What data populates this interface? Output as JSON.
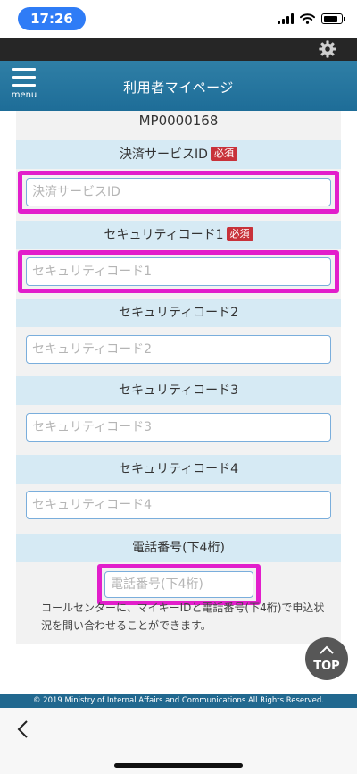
{
  "status_bar": {
    "time": "17:26"
  },
  "header": {
    "menu_label": "menu",
    "title": "利用者マイページ"
  },
  "user": {
    "id": "MP0000168"
  },
  "sections": [
    {
      "heading": "決済サービスID",
      "required_badge": "必須",
      "placeholder": "決済サービスID"
    },
    {
      "heading": "セキュリティコード1",
      "required_badge": "必須",
      "placeholder": "セキュリティコード1"
    },
    {
      "heading": "セキュリティコード2",
      "placeholder": "セキュリティコード2"
    },
    {
      "heading": "セキュリティコード3",
      "placeholder": "セキュリティコード3"
    },
    {
      "heading": "セキュリティコード4",
      "placeholder": "セキュリティコード4"
    },
    {
      "heading": "電話番号(下4桁)",
      "placeholder": "電話番号(下4桁)"
    }
  ],
  "note": "コールセンターに、マイキーIDと電話番号(下4桁)で申込状況を問い合わせることができます。",
  "top_button": {
    "label": "TOP"
  },
  "footer": {
    "copyright": "© 2019 Ministry of Internal Affairs and Communications All Rights Reserved."
  },
  "colors": {
    "header": "#1e6d98",
    "section_heading": "#d6eaf4",
    "required_badge": "#c8323a",
    "highlight": "#e21ecb",
    "field_border": "#7aaedc"
  }
}
